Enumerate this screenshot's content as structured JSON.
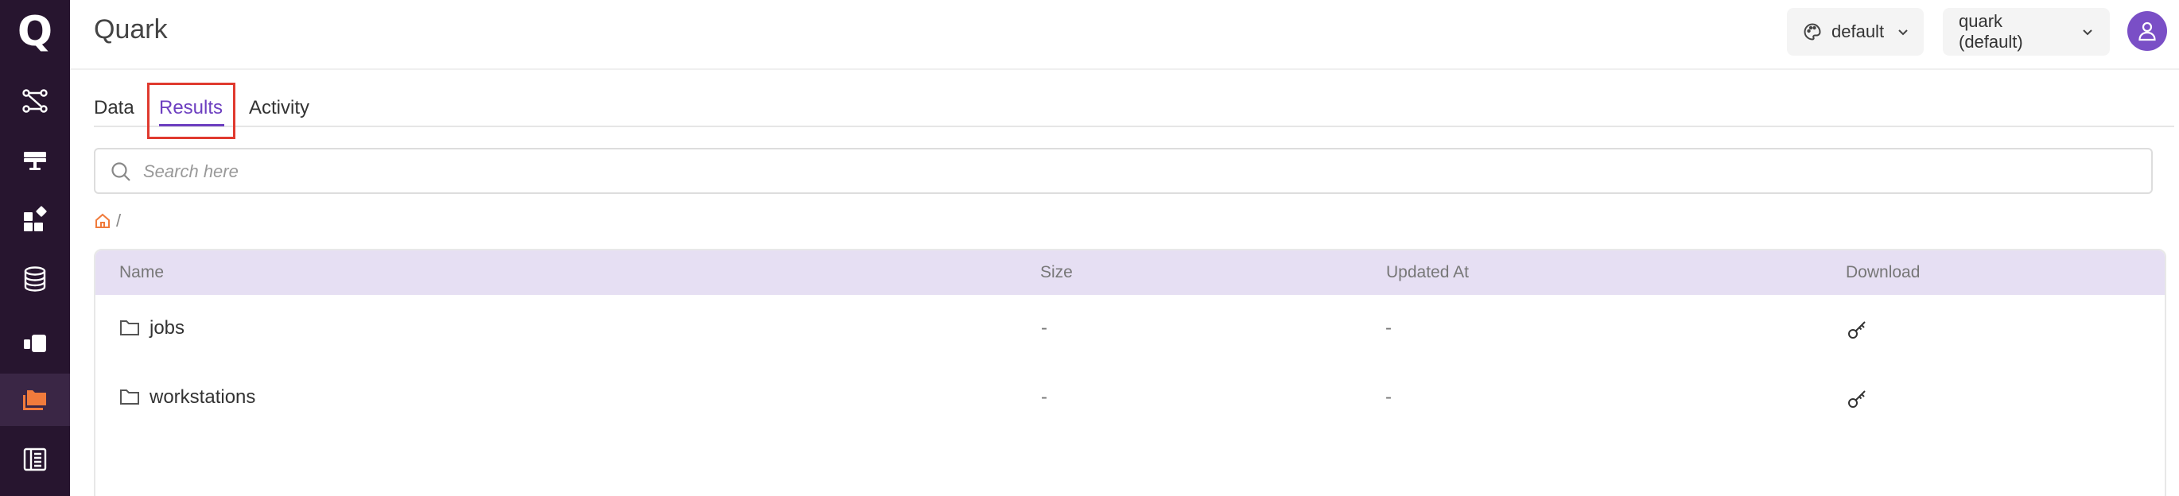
{
  "sidebar": {
    "logo": "Q",
    "items": [
      {
        "name": "workflow",
        "icon": "workflow-icon"
      },
      {
        "name": "workstations",
        "icon": "workstation-icon"
      },
      {
        "name": "apps",
        "icon": "apps-icon"
      },
      {
        "name": "datasets",
        "icon": "database-icon"
      },
      {
        "name": "sessions",
        "icon": "sessions-icon"
      },
      {
        "name": "files",
        "icon": "folders-icon",
        "active": true
      },
      {
        "name": "docs",
        "icon": "notebook-icon"
      }
    ],
    "active_color": "#f07b3c"
  },
  "header": {
    "title": "Quark",
    "palette_label": "default",
    "project_label": "quark (default)"
  },
  "tabs": [
    {
      "label": "Data"
    },
    {
      "label": "Results",
      "active": true
    },
    {
      "label": "Activity"
    }
  ],
  "search": {
    "placeholder": "Search here",
    "value": ""
  },
  "breadcrumb": {
    "separator": "/"
  },
  "table": {
    "columns": [
      "Name",
      "Size",
      "Updated At",
      "Download"
    ],
    "rows": [
      {
        "name": "jobs",
        "size": "-",
        "updated_at": "-"
      },
      {
        "name": "workstations",
        "size": "-",
        "updated_at": "-"
      }
    ]
  },
  "colors": {
    "sidebar_bg": "#27152f",
    "accent": "#6d3fc0",
    "table_header_bg": "#e6dff3",
    "highlight": "#e03a2f",
    "home": "#f07b3c"
  }
}
